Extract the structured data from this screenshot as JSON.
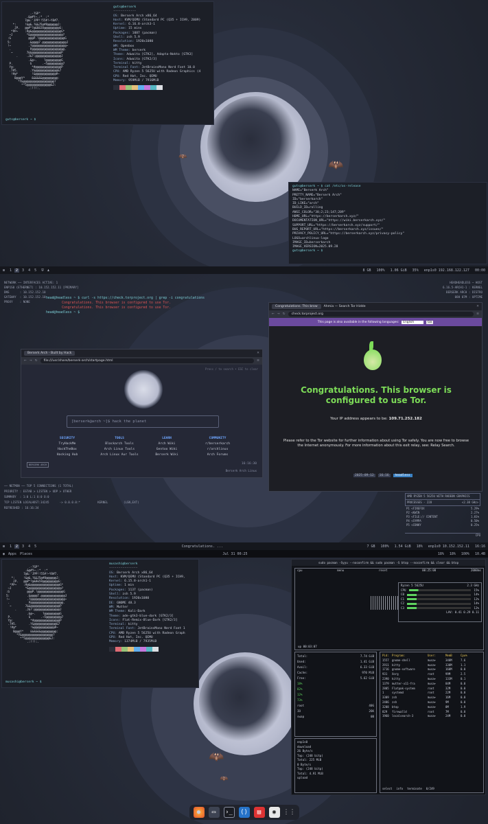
{
  "s1": {
    "neofetch": {
      "userhost": "guts@berserk",
      "sep": "------------",
      "rows": [
        [
          "OS:",
          "Berserk Arch x86_64"
        ],
        [
          "Host:",
          "KVM/QEMU (Standard PC (Q35 + ICH9, 2009)"
        ],
        [
          "Kernel:",
          "6.16.8-arch3-1"
        ],
        [
          "Uptime:",
          "15 mins"
        ],
        [
          "Packages:",
          "1087 (pacman)"
        ],
        [
          "Shell:",
          "zsh 5.9"
        ],
        [
          "Resolution:",
          "1920x1080"
        ],
        [
          "WM:",
          "Openbox"
        ],
        [
          "WM Theme:",
          "berserk"
        ],
        [
          "Theme:",
          "Adwaita [GTK2], Adapta-Nokto [GTK3]"
        ],
        [
          "Icons:",
          "Adwaita [GTK2/3]"
        ],
        [
          "Terminal:",
          "kitty"
        ],
        [
          "Terminal Font:",
          "JetBrainsMono Nerd Font 10.0"
        ],
        [
          "CPU:",
          "AMD Ryzen 5 5625U with Radeon Graphics (4"
        ],
        [
          "GPU:",
          "Red Hat, Inc. QEMU"
        ],
        [
          "Memory:",
          "959MiB / 7916MiB"
        ]
      ],
      "prompt": "guts@berserk ~ $"
    },
    "osrelease": {
      "cmd": "guts@berserk ~ $ cat /etc/os-release",
      "lines": [
        "NAME=\"Berserk Arch\"",
        "PRETTY_NAME=\"Berserk Arch\"",
        "ID=\"berserkarch\"",
        "ID_LIKE=\"arch\"",
        "BUILD_ID=rolling",
        "ANSI_COLOR=\"38;2;23;147;209\"",
        "HOME_URL=\"https://berserkarch.xyz/\"",
        "DOCUMENTATION_URL=\"https://wiki.berserkarch.xyz/\"",
        "SUPPORT_URL=\"https://berserkarch.xyz/support/\"",
        "BUG_REPORT_URL=\"https://berserkarch.xyz/issues/\"",
        "PRIVACY_POLICY_URL=\"https://berserkarch.xyz/privacy-policy\"",
        "LOGO=archlinux-logo",
        "IMAGE_ID=berserkarch",
        "IMAGE_VERSION=2025.09.28"
      ],
      "prompt": "guts@berserk ~ $"
    }
  },
  "bar2": {
    "workspaces": [
      "1",
      "2",
      "3",
      "4",
      "5"
    ],
    "right": [
      "8 GB",
      "100%",
      "1.06 GiB",
      "35%",
      "enp1s0 192.168.122.127",
      "00:00"
    ]
  },
  "s2": {
    "network_widget": [
      "NETWORK ── INTERFACES ACTIVE: 1",
      "ENP1S0 (ETHERNET) : 10.152.152.11 [PRIMARY]",
      "DNS      : 10.152.152.10",
      "GATEWAY  : 10.152.152.10",
      "PROXY    : NONE"
    ],
    "host_widget": [
      "HEADHEADLESS ─ HOST",
      "6.16.5-ARCH1-1 : KERNEL",
      "BERSERK ARCH : DISTRO",
      "08H 07M : UPTIME"
    ],
    "torterm": [
      "head@headless ~ $ curl -s https://check.torproject.org | grep -i congratulations",
      "        Congratulations. This browser is configured to use Tor.",
      "        Congratulations. This browser is configured to use Tor.",
      "head@headless ~ $"
    ],
    "tor": {
      "tab1": "Congratulations. This brow",
      "tab2": "Ahmia — Search Tor Hidde",
      "url": "check.torproject.org",
      "lang_bar": "This page is also available in the following languages:",
      "lang": "English",
      "go": "Go",
      "headline": "Congratulations. This browser is configured to use Tor.",
      "ip_label": "Your IP address appears to be:",
      "ip": "109.71.252.182",
      "info": "Please refer to the Tor website for further information about using Tor safely. You are now free to browse the Internet anonymously. For more information about this exit relay, see: Relay Search."
    },
    "start": {
      "tab": "Berserk Arch - Built by Hack",
      "url": "file:///usr/share/berserk-arch/startpage.html",
      "hint": "Press / to search • ESC to clear",
      "search": "[berserk@arch ~]$ hack the planet",
      "cols": [
        {
          "h": "SECURITY",
          "items": [
            "TryHackMe",
            "HackTheBox",
            "Hacking Hub"
          ]
        },
        {
          "h": "TOOLS",
          "items": [
            "Blackarch Tools",
            "Arch Linux Tools",
            "Arch Linux Aur Tools"
          ]
        },
        {
          "h": "LEARN",
          "items": [
            "Arch Wiki",
            "Gentoo Wiki",
            "Berserk Wiki"
          ]
        },
        {
          "h": "COMMUNITY",
          "items": [
            "r/berserkarch",
            "r/archlinux",
            "Arch Forums"
          ]
        }
      ],
      "badge": "BERSERK ARCH",
      "time": "16:16:30",
      "footer": "Berserk Arch Linux"
    },
    "statusline": {
      "date": "2025-09-12",
      "time": "16:16",
      "tag": "headless"
    },
    "netmon": [
      "── NETMON ── TOP 5 CONNECTIONS (1 TOTAL)",
      "PRIORITY : ESTAB > LISTEN > UDP > OTHER",
      "SUMMARY  : 1:0 L:1 U:0 O:0",
      "TCP LISTEN LOCALHOST:34245      -> 0.0.0.0:*          KERNEL         (LSN,EXT)",
      "REFRESHED : 16:16:34"
    ],
    "cpu_widget": {
      "title": "AMD RYZEN 5 5625U WITH RADEON GRAPHICS",
      "procs": "PROCESSES - 228",
      "freq": "<2.38 GHz>",
      "rows": [
        [
          "P1 <FIREFOX",
          "5.29%"
        ],
        [
          "P2 <KWIN",
          "2.27%"
        ],
        [
          "P3 <FILE:// CONTENT",
          "1.01%"
        ],
        [
          "P4 <SYMPA",
          "0.50%"
        ],
        [
          "P5 <CONKY",
          "0.25%"
        ]
      ],
      "label": "CPU"
    }
  },
  "bar3": {
    "left": [
      "Apps",
      "Places"
    ],
    "center": "Jul 31  00:25",
    "right": [
      "18%",
      "18%",
      "100%",
      "10.4B"
    ],
    "top_title": "Congratulations. ...",
    "top_right": [
      "7 GB",
      "100%",
      "1.54 GiB",
      "18%",
      "enp1s0 10.152.152.11",
      "16:16"
    ]
  },
  "s3": {
    "neofetch": {
      "userhost": "musashi@berserk",
      "sep": "---------------",
      "rows": [
        [
          "OS:",
          "Berserk Arch x86_64"
        ],
        [
          "Host:",
          "KVM/QEMU (Standard PC (Q35 + ICH9,"
        ],
        [
          "Kernel:",
          "6.15.8-arch1-1"
        ],
        [
          "Uptime:",
          "1 min"
        ],
        [
          "Packages:",
          "1137 (pacman)"
        ],
        [
          "Shell:",
          "zsh 5.9"
        ],
        [
          "Resolution:",
          "1920x1080"
        ],
        [
          "DE:",
          "GNOME 48.3"
        ],
        [
          "WM:",
          "Mutter"
        ],
        [
          "WM Theme:",
          "Kali-Dark"
        ],
        [
          "Theme:",
          "ade-gtk3-blue-dark [GTK2/3]"
        ],
        [
          "Icons:",
          "Flat-Remix-Blue-Dark [GTK2/3]"
        ],
        [
          "Terminal:",
          "kitty"
        ],
        [
          "Terminal Font:",
          "JetBrainsMono Nerd Font 1"
        ],
        [
          "CPU:",
          "AMD Ryzen 5 5625U with Radeon Graph"
        ],
        [
          "GPU:",
          "Red Hat, Inc. QEMU"
        ],
        [
          "Memory:",
          "1374MiB / 7935MiB"
        ]
      ],
      "prompt": "musashi@berserk ~ $"
    },
    "btop": {
      "title": "sudo pacman -Syyu --noconfirm && sudo pacman -S btop --noconfirm && clear && btop",
      "header": [
        "cpu",
        "menu",
        "reset",
        "00:25:08",
        "2000ms"
      ],
      "cpu_name": "Ryzen 5 5625U",
      "cpu_freq": "2.3 GHz",
      "cores": [
        [
          "CPU",
          "15%"
        ],
        [
          "C0",
          "14%"
        ],
        [
          "C1",
          "12%"
        ],
        [
          "C2",
          "14%"
        ],
        [
          "C3",
          "12%"
        ]
      ],
      "lav": "LAV: 0.41 0.29 0.11",
      "uptime": "up 00:03:07",
      "mem": [
        [
          "Total:",
          "7.74 GiB"
        ],
        [
          "Used:",
          "1.41 GiB"
        ],
        [
          "Avail:",
          "6.33 GiB"
        ],
        [
          "Cache:",
          "970 MiB"
        ],
        [
          "Free:",
          "5.62 GiB"
        ]
      ],
      "mem_pct": [
        "18%",
        "82%",
        "12%",
        "73%"
      ],
      "disks": [
        [
          "root",
          "40G"
        ],
        [
          "IO",
          "26K"
        ],
        [
          "swap",
          "0B"
        ]
      ],
      "net": [
        "enp1s0",
        "download",
        "26 Byte/s",
        "Top: (248 bitp)",
        "Total: 225 MiB",
        "0 Byte/s",
        "Top: (248 bitp)",
        "Total: 4.91 MiB",
        "upload"
      ],
      "procs_head": [
        "Pid:",
        "Program:",
        "User:",
        "MemB",
        "Cpu%"
      ],
      "procs": [
        [
          "1557",
          "gnome-shell",
          "musa+",
          "348M",
          "7.6"
        ],
        [
          "2911",
          "kitty",
          "musa+",
          "338M",
          "1.1"
        ],
        [
          "1716",
          "gnome-software",
          "musa+",
          "160M",
          "0.0"
        ],
        [
          "931",
          "Xorg",
          "root",
          "99M",
          "2.5"
        ],
        [
          "2390",
          "kitty",
          "musa+",
          "133M",
          "0.1"
        ],
        [
          "1379",
          "mutter-x11-fra",
          "musa+",
          "84M",
          "0.0"
        ],
        [
          "2805",
          "Flatpak-system",
          "root",
          "32M",
          "0.0"
        ],
        [
          "1",
          "systemd",
          "root",
          "22M",
          "0.0"
        ],
        [
          "3309",
          "zsh",
          "musa+",
          "16M",
          "0.0"
        ],
        [
          "2486",
          "zsh",
          "musa+",
          "9M",
          "0.0"
        ],
        [
          "3208",
          "btop",
          "musa+",
          "8M",
          "1.9"
        ],
        [
          "829",
          "firewalld",
          "root",
          "7M",
          "0.0"
        ],
        [
          "1960",
          "localsearch-3",
          "musa+",
          "24M",
          "0.0"
        ]
      ],
      "footer": [
        "select",
        "info",
        "terminate",
        "0/249"
      ]
    },
    "dock": [
      "firefox",
      "files",
      "terminal",
      "vscode",
      "app",
      "settings",
      "apps"
    ]
  },
  "colors": {
    "accent": "#6fa6ff",
    "tor_green": "#7ddc58",
    "tor_purple": "#6b4a9e",
    "bg": "#1b1e27"
  }
}
